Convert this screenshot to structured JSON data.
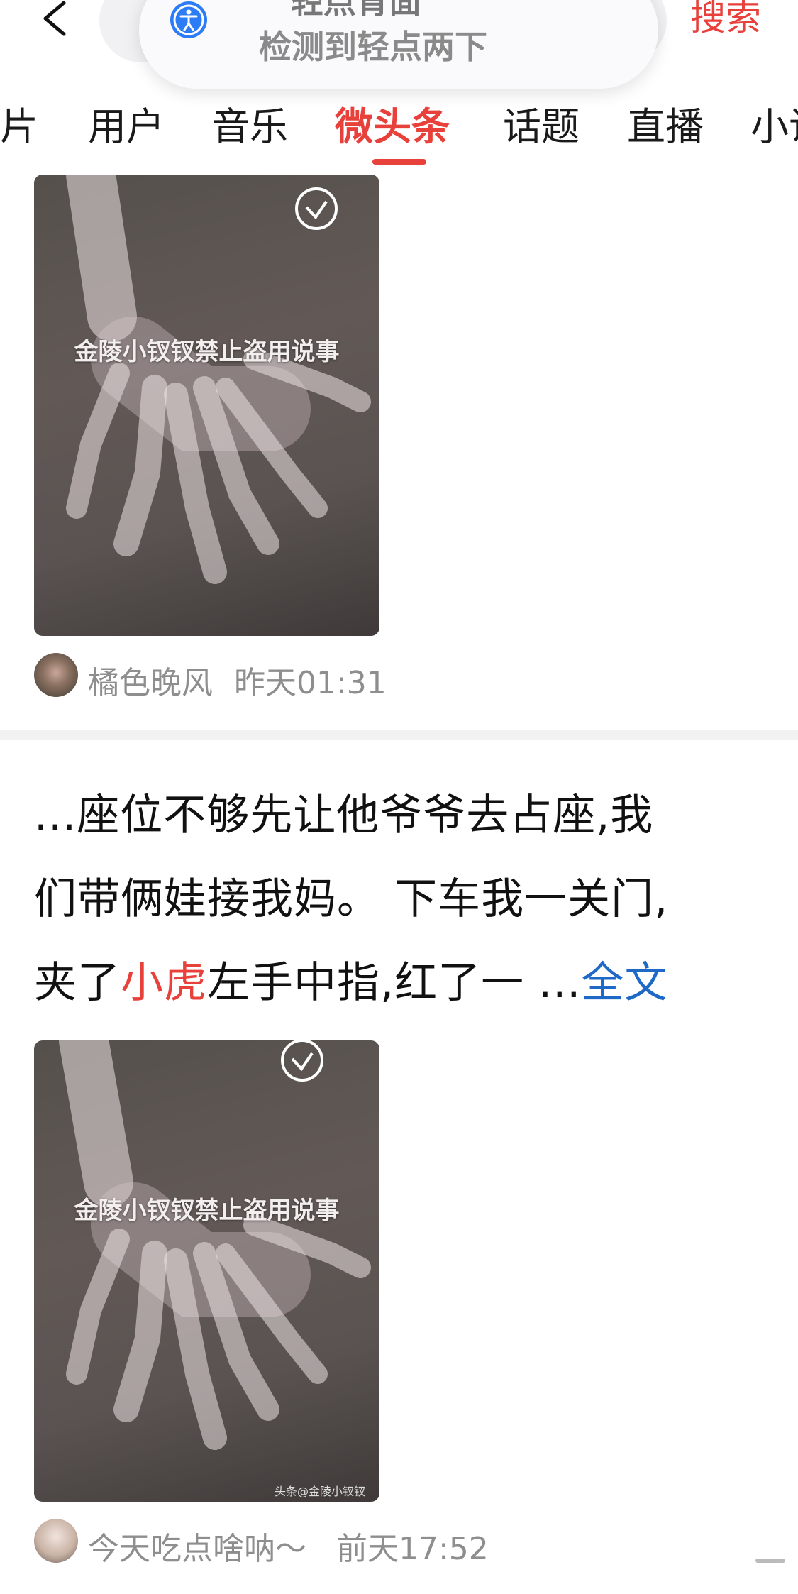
{
  "topbar": {
    "back_icon": "chevron-left-icon",
    "search_button": "搜索"
  },
  "accessibility_toast": {
    "icon": "accessibility-icon",
    "title": "轻点背面",
    "subtitle": "检测到轻点两下"
  },
  "tabs": [
    {
      "label": "图片",
      "active": false
    },
    {
      "label": "用户",
      "active": false
    },
    {
      "label": "音乐",
      "active": false
    },
    {
      "label": "微头条",
      "active": true
    },
    {
      "label": "话题",
      "active": false
    },
    {
      "label": "直播",
      "active": false
    },
    {
      "label": "小说",
      "active": false
    }
  ],
  "posts": [
    {
      "image_watermark": "金陵小钗钗禁止盗用说事",
      "author": "橘色晚风",
      "time": "昨天01:31"
    },
    {
      "text_lines": [
        "...座位不够先让他爷爷去占座,我",
        "们带俩娃接我妈。 下车我一关门,"
      ],
      "last_line_before": "夹了",
      "highlight": "小虎",
      "last_line_after": "左手中指,红了一 ...",
      "more_link": "全文",
      "image_watermark": "金陵小钗钗禁止盗用说事",
      "image_credit": "头条@金陵小钗钗",
      "author": "今天吃点啥呐～",
      "time": "前天17:52"
    }
  ],
  "colors": {
    "accent": "#e8403a",
    "link": "#1e69c8",
    "meta": "#8e8e8e"
  }
}
